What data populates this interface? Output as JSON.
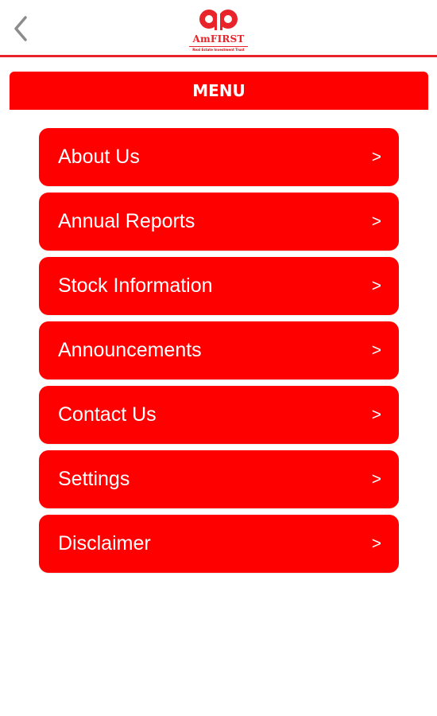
{
  "header": {
    "back_icon": "chevron-left-icon",
    "logo": {
      "brand": "AmFIRST",
      "tagline": "Real Estate Investment Trust"
    }
  },
  "menu": {
    "title": "MENU",
    "items": [
      {
        "label": "About Us",
        "arrow": ">"
      },
      {
        "label": "Annual Reports",
        "arrow": ">"
      },
      {
        "label": "Stock Information",
        "arrow": ">"
      },
      {
        "label": "Announcements",
        "arrow": ">"
      },
      {
        "label": "Contact Us",
        "arrow": ">"
      },
      {
        "label": "Settings",
        "arrow": ">"
      },
      {
        "label": "Disclaimer",
        "arrow": ">"
      }
    ]
  },
  "colors": {
    "accent": "#ff0000",
    "header_border": "#e8232a",
    "back_icon": "#8c8c8c",
    "text_on_accent": "#ffffff"
  }
}
